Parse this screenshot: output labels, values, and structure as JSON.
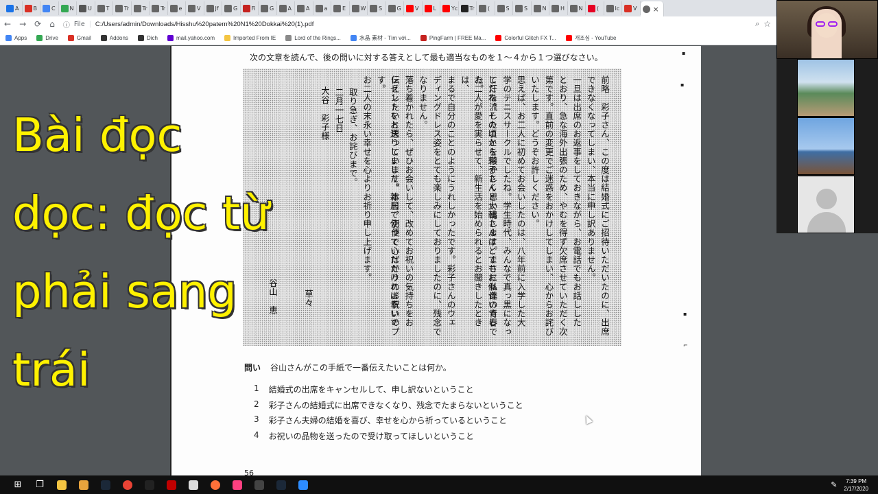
{
  "browser": {
    "tabs": [
      {
        "label": "A",
        "color": "#1a73e8"
      },
      {
        "label": "B",
        "color": "#d93025"
      },
      {
        "label": "C",
        "color": "#4285f4"
      },
      {
        "label": "N",
        "color": "#34a853"
      },
      {
        "label": "U",
        "color": "#555555"
      },
      {
        "label": "T",
        "color": "#666666"
      },
      {
        "label": "Tr",
        "color": "#666666"
      },
      {
        "label": "Tr",
        "color": "#666666"
      },
      {
        "label": "Tr",
        "color": "#666666"
      },
      {
        "label": "e",
        "color": "#666666"
      },
      {
        "label": "V",
        "color": "#666666"
      },
      {
        "label": "Jf",
        "color": "#666666"
      },
      {
        "label": "G",
        "color": "#666666"
      },
      {
        "label": "Fi",
        "color": "#c5221f"
      },
      {
        "label": "G",
        "color": "#666666"
      },
      {
        "label": "A",
        "color": "#666666"
      },
      {
        "label": "A",
        "color": "#666666"
      },
      {
        "label": "a",
        "color": "#666666"
      },
      {
        "label": "E",
        "color": "#666666"
      },
      {
        "label": "W",
        "color": "#666666"
      },
      {
        "label": "S",
        "color": "#666666"
      },
      {
        "label": "G",
        "color": "#666666"
      },
      {
        "label": "V",
        "color": "#ff0000"
      },
      {
        "label": "L",
        "color": "#ff0000"
      },
      {
        "label": "Yc",
        "color": "#ff0000"
      },
      {
        "label": "Tr",
        "color": "#222222"
      },
      {
        "label": "(",
        "color": "#666666"
      },
      {
        "label": "S",
        "color": "#666666"
      },
      {
        "label": "S",
        "color": "#666666"
      },
      {
        "label": "N",
        "color": "#666666"
      },
      {
        "label": "H",
        "color": "#666666"
      },
      {
        "label": "N",
        "color": "#666666"
      },
      {
        "label": "(",
        "color": "#e60023"
      },
      {
        "label": "Ic",
        "color": "#666666"
      },
      {
        "label": "V",
        "color": "#d93025"
      }
    ],
    "active_tab": {
      "label": "",
      "color": "#666666"
    },
    "nav": {
      "back": "←",
      "forward": "→",
      "reload": "⟳",
      "home": "⌂"
    },
    "address": {
      "scheme_label": "File",
      "url": "C:/Users/admin/Downloads/Hisshu%20patern%20N1%20Dokkai%20(1).pdf"
    },
    "bookmarks": [
      {
        "label": "Apps",
        "color": "#4285f4"
      },
      {
        "label": "Drive",
        "color": "#34a853"
      },
      {
        "label": "Gmail",
        "color": "#d93025"
      },
      {
        "label": "Addons",
        "color": "#333333"
      },
      {
        "label": "Dich",
        "color": "#333333"
      },
      {
        "label": "mail.yahoo.com",
        "color": "#6001d2"
      },
      {
        "label": "Imported From IE",
        "color": "#f4c542"
      },
      {
        "label": "Lord of the Rings...",
        "color": "#8a8a8a"
      },
      {
        "label": "水晶 素材 - Tìm với...",
        "color": "#4285f4"
      },
      {
        "label": "PingFarm | FREE Ma...",
        "color": "#c5221f"
      },
      {
        "label": "Colorful Glitch FX T...",
        "color": "#ff0000"
      },
      {
        "label": "개조심 - YouTube",
        "color": "#ff0000"
      }
    ]
  },
  "pdf": {
    "instruction": "次の文章を読んで、後の問いに対する答えとして最も適当なものを１～４から１つ選びなさい。",
    "letter_columns": [
      "前略　彩子さん、この度は結婚式にご招待いただいたのに、出席",
      "できなくなってしまい、本当に申し訳ありません。",
      "一旦は出席のお返事をしておきながら、お電話でもお話しした",
      "とおり、急な海外出張のため、やむを得ず欠席させていただく次",
      "第です。直前の変更でご迷惑をおかけしてしまい、心からお詫び",
      "いたします。どうぞお許しください。",
      "思えば、お二人に初めてお会いしたのは、八年前に入学した大",
      "学のテニスサークルでしたね。学生時代、みんなで真っ黒になっ",
      "て汗を流したことを懐かしく思い出します。まさに私達の青春で",
      "したね。その頃から彩子さんと大輔さんはとてもお似合いでした。",
      "お二人が愛を実らせて、新生活を始められるとお聞きしたときは、",
      "まるで自分のことのようにうれしかったです。彩子さんのウェ",
      "ディングドレス姿をとても楽しみにしておりましたのに、残念で",
      "なりません。",
      "落ち着かれたら、ぜひお会いして、改めてお祝いの気持ちをお",
      "伝えしたいと思っています。本日、別便で心ばかりのお祝いのプ",
      "レゼントをお送りしました。新居で使っていただければ幸いです。",
      "お二人の末永い幸せを心よりお祈り申し上げます。",
      "取り急ぎ、お詫びまで。",
      "二月一七日",
      "大谷　彩子様"
    ],
    "signoff": "草々",
    "sender": "谷山　恵",
    "question_label": "問い",
    "question": "谷山さんがこの手紙で一番伝えたいことは何か。",
    "options": [
      {
        "num": "1",
        "text": "結婚式の出席をキャンセルして、申し訳ないということ"
      },
      {
        "num": "2",
        "text": "彩子さんの結婚式に出席できなくなり、残念でたまらないということ"
      },
      {
        "num": "3",
        "text": "彩子さん夫婦の結婚を喜び、幸せを心から祈っているということ"
      },
      {
        "num": "4",
        "text": "お祝いの品物を送ったので受け取ってほしいということ"
      }
    ],
    "page_number": "56"
  },
  "overlay": {
    "caption": "Bài đọc dọc: đọc từ phải sang trái",
    "color": "#fff200"
  },
  "taskbar": {
    "icons": [
      "start-icon",
      "task-view-icon",
      "file-explorer-icon",
      "folder-icon",
      "steam-icon",
      "chrome-icon",
      "unity-icon",
      "app-icon",
      "settings-icon",
      "firefox-icon",
      "paint-icon",
      "media-icon",
      "steam-icon-2",
      "zoom-icon"
    ],
    "time": "7:39 PM",
    "date": "2/17/2020"
  }
}
